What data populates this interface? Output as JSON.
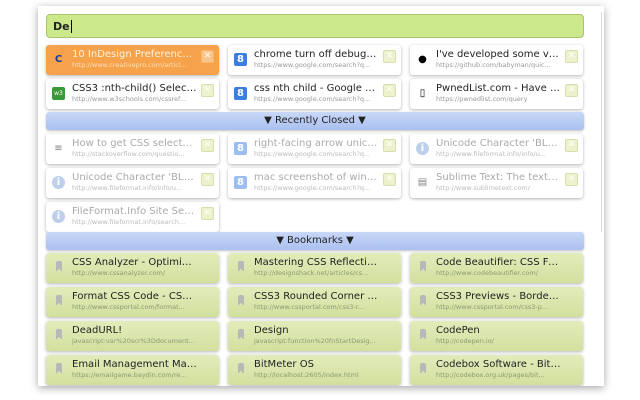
{
  "search": {
    "value": "De"
  },
  "sections": {
    "recently_closed": "▼ Recently Closed ▼",
    "bookmarks": "▼ Bookmarks ▼"
  },
  "tabs": [
    {
      "title": "10 InDesign Preferences ...",
      "url": "http://www.creativepro.com/articl...",
      "icon": "creativepro-icon"
    },
    {
      "title": "chrome turn off debugge...",
      "url": "https://www.google.com/search?q...",
      "icon": "google-icon"
    },
    {
      "title": "I've developed some very ...",
      "url": "https://github.com/babyman/quic...",
      "icon": "github-icon"
    },
    {
      "title": "CSS3 :nth-child() Selector",
      "url": "http://www.w3schools.com/cssref...",
      "icon": "w3schools-icon"
    },
    {
      "title": "css nth child - Google Se...",
      "url": "https://www.google.com/search?q...",
      "icon": "google-icon"
    },
    {
      "title": "PwnedList.com - Have Yo...",
      "url": "https://pwnedlist.com/query",
      "icon": "page-icon"
    }
  ],
  "closed": [
    {
      "title": "How to get CSS selectors ...",
      "url": "http://stackoverflow.com/questio...",
      "icon": "stackoverflow-icon"
    },
    {
      "title": "right-facing arrow unico...",
      "url": "https://www.google.com/search?q...",
      "icon": "google-icon"
    },
    {
      "title": "Unicode Character 'BLAC...",
      "url": "http://www.fileformat.info/info/u...",
      "icon": "info-icon"
    },
    {
      "title": "Unicode Character 'BLAC...",
      "url": "http://www.fileformat.info/info/u...",
      "icon": "info-icon"
    },
    {
      "title": "mac screenshot of windo...",
      "url": "https://www.google.com/search?q...",
      "icon": "google-icon"
    },
    {
      "title": "Sublime Text: The text e...",
      "url": "http://www.sublimetext.com/",
      "icon": "sublime-icon"
    },
    {
      "title": "FileFormat.Info Site Search",
      "url": "http://www.fileformat.info/search...",
      "icon": "info-icon"
    }
  ],
  "bookmarks": [
    {
      "title": "CSS Analyzer - Optimize ...",
      "url": "http://www.cssanalyzer.com/"
    },
    {
      "title": "Mastering CSS Reflection...",
      "url": "http://designshack.net/articles/cs..."
    },
    {
      "title": "Code Beautifier: CSS For...",
      "url": "http://www.codebeautifier.com/"
    },
    {
      "title": "Format CSS Code - CSS P...",
      "url": "http://www.cssportal.com/format..."
    },
    {
      "title": "CSS3 Rounded Corner Ge...",
      "url": "http://www.cssportal.com/css3-r..."
    },
    {
      "title": "CSS3 Previews - Borders ...",
      "url": "http://www.cssportal.com/css3-p..."
    },
    {
      "title": "DeadURL!",
      "url": "javascript:var%20scr%3Ddocument..."
    },
    {
      "title": "Design",
      "url": "javascript:function%20fnStartDesig..."
    },
    {
      "title": "CodePen",
      "url": "http://codepen.io/"
    },
    {
      "title": "Email Management Made ...",
      "url": "https://emailgame.baydin.com/re..."
    },
    {
      "title": "BitMeter OS",
      "url": "http://localhost:2605/index.html"
    },
    {
      "title": "Codebox Software - BitM...",
      "url": "http://codebox.org.uk/pages/bit..."
    }
  ]
}
